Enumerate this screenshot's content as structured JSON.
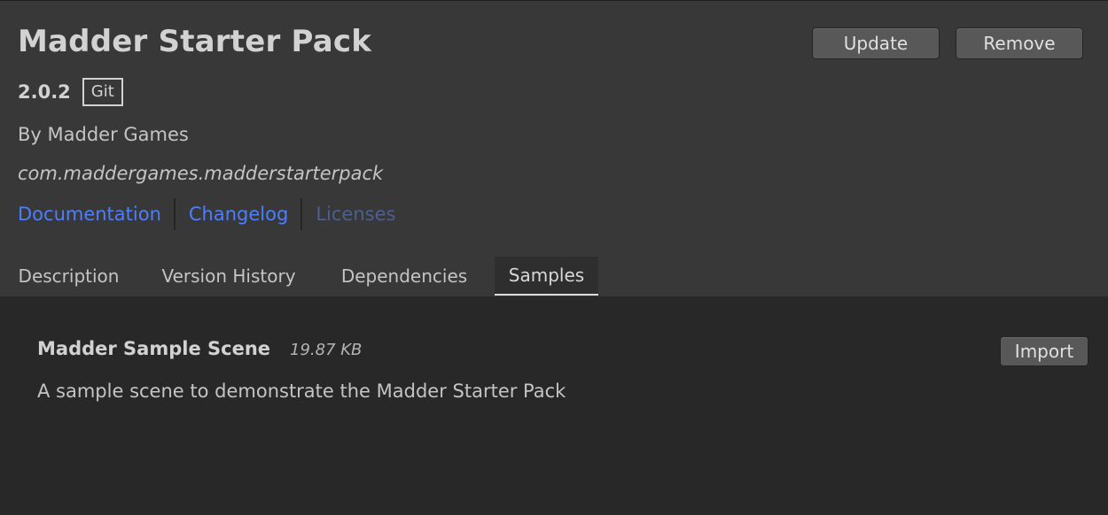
{
  "package": {
    "title": "Madder Starter Pack",
    "version": "2.0.2",
    "source": "Git",
    "author": "By Madder Games",
    "id": "com.maddergames.madderstarterpack"
  },
  "links": [
    {
      "label": "Documentation",
      "enabled": true
    },
    {
      "label": "Changelog",
      "enabled": true
    },
    {
      "label": "Licenses",
      "enabled": false
    }
  ],
  "actions": {
    "update_label": "Update",
    "remove_label": "Remove"
  },
  "tabs": [
    {
      "label": "Description",
      "active": false
    },
    {
      "label": "Version History",
      "active": false
    },
    {
      "label": "Dependencies",
      "active": false
    },
    {
      "label": "Samples",
      "active": true
    }
  ],
  "samples": [
    {
      "name": "Madder Sample Scene",
      "size": "19.87 KB",
      "description": "A sample scene to demonstrate the Madder Starter Pack",
      "import_label": "Import"
    }
  ],
  "colors": {
    "header_bg": "#383838",
    "content_bg": "#282828",
    "link": "#4c7efd",
    "link_disabled": "#4c5f8f",
    "button_bg": "#585858"
  }
}
